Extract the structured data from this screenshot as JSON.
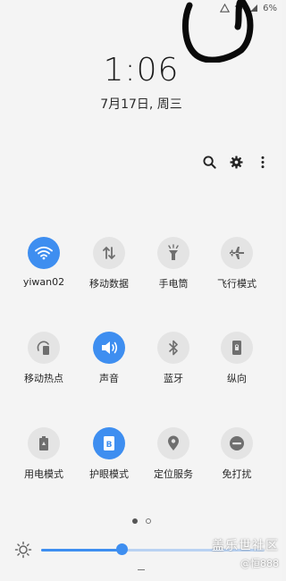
{
  "status_bar": {
    "battery": "6%"
  },
  "clock": {
    "time": "1:06",
    "date": "7月17日, 周三"
  },
  "toolbar": {
    "search": "search-icon",
    "settings": "gear-icon",
    "more": "more-icon"
  },
  "tiles": [
    {
      "label": "yiwan02",
      "icon": "wifi-icon",
      "on": true
    },
    {
      "label": "移动数据",
      "icon": "mobile-data-icon",
      "on": false
    },
    {
      "label": "手电筒",
      "icon": "flashlight-icon",
      "on": false
    },
    {
      "label": "飞行模式",
      "icon": "airplane-icon",
      "on": false
    },
    {
      "label": "移动热点",
      "icon": "hotspot-icon",
      "on": false
    },
    {
      "label": "声音",
      "icon": "sound-icon",
      "on": true
    },
    {
      "label": "蓝牙",
      "icon": "bluetooth-icon",
      "on": false
    },
    {
      "label": "纵向",
      "icon": "portrait-icon",
      "on": false
    },
    {
      "label": "用电模式",
      "icon": "power-mode-icon",
      "on": false
    },
    {
      "label": "护眼模式",
      "icon": "eye-comfort-icon",
      "on": true
    },
    {
      "label": "定位服务",
      "icon": "location-icon",
      "on": false
    },
    {
      "label": "免打扰",
      "icon": "do-not-disturb-icon",
      "on": false
    }
  ],
  "pagination": {
    "current": 1,
    "total": 2
  },
  "brightness": {
    "level": 0.36
  },
  "colors": {
    "accent": "#3e8ef0",
    "tile_off": "#e4e4e4",
    "background": "#f4f4f4"
  },
  "watermark": {
    "line1": "盖乐世社区",
    "line2": "@恒888"
  }
}
